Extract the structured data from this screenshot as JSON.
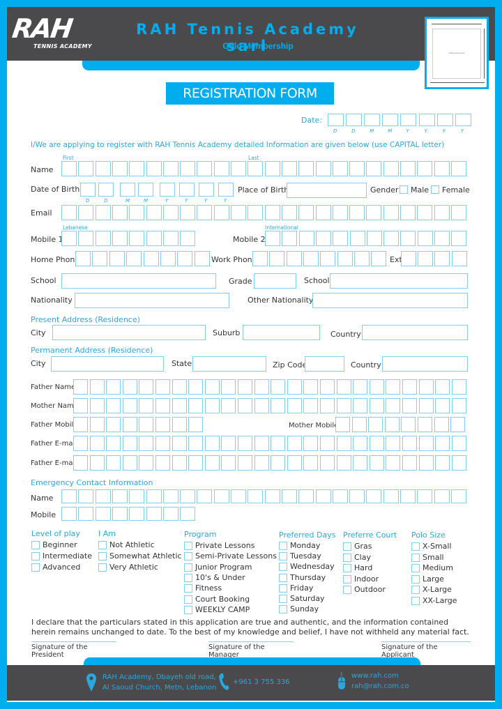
{
  "header": {
    "logo_text": "RAH",
    "logo_subtext": "TENNIS ACADEMY",
    "title": "RAH Tennis Academy sarl",
    "subtitle": "Gold Membership",
    "photo_label": "Paste photo here"
  },
  "form_title": "REGISTRATION FORM",
  "date": {
    "label": "Date:",
    "slots": [
      "D",
      "D",
      "M",
      "M",
      "Y",
      "Y",
      "Y",
      "Y"
    ]
  },
  "intro": "I/We are applying to register with RAH Tennis Academy detailed Information are given below (use CAPITAL letter)",
  "personal": {
    "name_label": "Name",
    "first_hint": "First",
    "last_hint": "Last",
    "dob_label": "Date of Birth",
    "dob_slots": [
      "D",
      "D",
      "M",
      "M",
      "Y",
      "Y",
      "Y",
      "Y"
    ],
    "place_of_birth_label": "Place of Birth",
    "gender_label": "Gender",
    "gender_options": [
      "Male",
      "Female"
    ],
    "email_label": "Email",
    "mobile1_label": "Mobile 1",
    "mobile1_hint": "Lebanese",
    "mobile2_label": "Mobile 2",
    "mobile2_hint": "International",
    "home_phone_label": "Home Phone",
    "work_phone_label": "Work Phone",
    "ext_label": "Ext",
    "school_label": "School",
    "grade_label": "Grade",
    "school2_label": "School",
    "nationality_label": "Nationality",
    "other_nationality_label": "Other Nationality"
  },
  "present_address": {
    "heading": "Present Address (Residence)",
    "city_label": "City",
    "suburb_label": "Suburb",
    "country_label": "Country"
  },
  "permanent_address": {
    "heading": "Permanent Address (Residence)",
    "city_label": "City",
    "state_label": "State",
    "zip_label": "Zip Code",
    "country_label": "Country"
  },
  "parents": {
    "father_name_label": "Father Name",
    "mother_name_label": "Mother Name",
    "father_mobile_label": "Father Mobile",
    "mother_mobile_label": "Mother Mobile",
    "father_email_label": "Father E-mail",
    "father_email2_label": "Father E-mail"
  },
  "emergency": {
    "heading": "Emergency Contact Information",
    "name_label": "Name",
    "mobile_label": "Mobile"
  },
  "options": {
    "level_of_play": {
      "heading": "Level of play",
      "items": [
        "Beginner",
        "Intermediate",
        "Advanced"
      ]
    },
    "i_am": {
      "heading": "I Am",
      "items": [
        "Not Athletic",
        "Somewhat Athletic",
        "Very Athletic"
      ]
    },
    "program": {
      "heading": "Program",
      "items": [
        "Private Lessons",
        "Semi-Private Lessons",
        "Junior Program",
        "10's & Under",
        "Fitness",
        "Court Booking",
        "WEEKLY CAMP"
      ]
    },
    "preferred_days": {
      "heading": "Preferred Days",
      "items": [
        "Monday",
        "Tuesday",
        "Wednesday",
        "Thursday",
        "Friday",
        "Saturday",
        "Sunday"
      ]
    },
    "preferred_court": {
      "heading": "Preferre Court",
      "items": [
        "Gras",
        "Clay",
        "Hard",
        "Indoor",
        "Outdoor"
      ]
    },
    "polo_size": {
      "heading": "Polo Size",
      "items": [
        "X-Small",
        "Small",
        "Medium",
        "Large",
        "X-Large",
        "XX-Large"
      ]
    }
  },
  "declaration": "I declare that the particulars stated in this application are true and authentic,  and  the  information  contained  herein remains  unchanged  to  date.  To the best of my knowledge and belief, I have not withheld any material fact.",
  "signatures": [
    "Signature of the President",
    "Signature of the Manager",
    "Signature of the Applicant"
  ],
  "footer": {
    "address_line1": "RAH Academy, Dbayeh old road,",
    "address_line2": "Al Saoud Church, Metn, Lebanon",
    "phone": "+961 3 755 336",
    "website": "www.rah.com",
    "email": "rah@rah.com.co"
  },
  "colors": {
    "accent": "#00aeef",
    "header_bg": "#4a4a4c",
    "box_border": "#7fd0ef"
  }
}
